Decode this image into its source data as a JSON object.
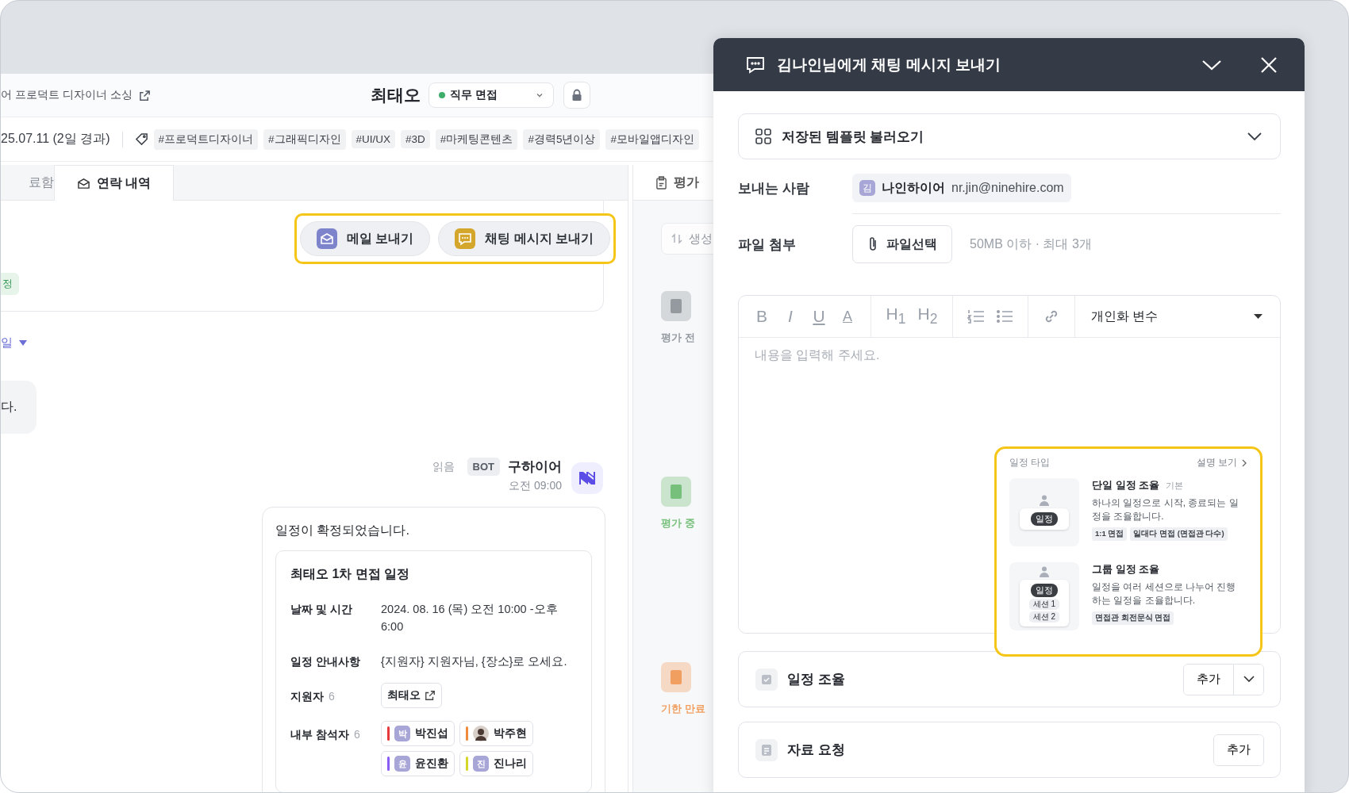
{
  "page": {
    "breadcrumb": "어 프로덕트 디자이너 소싱",
    "candidate_name": "최태오",
    "stage": {
      "label": "직무 면접",
      "color": "#3fae6a"
    },
    "date": "25.07.11 (2일 경과)",
    "tags": [
      "#프로덕트디자이너",
      "#그래픽디자인",
      "#UI/UX",
      "#3D",
      "#마케팅콘텐츠",
      "#경력5년이상",
      "#모바일앱디자인"
    ]
  },
  "tabs": [
    {
      "label": "료함",
      "selected": false
    },
    {
      "label": "연락 내역",
      "selected": true
    }
  ],
  "actions": [
    {
      "kind": "mail",
      "label": "메일 보내기"
    },
    {
      "kind": "chat",
      "label": "채팅 메시지 보내기"
    }
  ],
  "timeline": {
    "status_tag": "정",
    "filter": "일",
    "bubble": "다.",
    "message": {
      "read": "읽음",
      "badge": "BOT",
      "sender": "구하이어",
      "time": "오전 09:00",
      "text": "일정이 확정되었습니다.",
      "schedule": {
        "title": "최태오 1차 면접 일정",
        "rows": [
          {
            "kind": "text",
            "label": "날짜 및 시간",
            "value": "2024. 08. 16 (목) 오전 10:00 -오후 6:00"
          },
          {
            "kind": "text",
            "label": "일정 안내사항",
            "value": "{지원자} 지원자님, {장소}로 오세요."
          },
          {
            "kind": "applicants",
            "label": "지원자",
            "count": "6",
            "people": [
              {
                "name": "최태오"
              }
            ]
          },
          {
            "kind": "participants",
            "label": "내부 참석자",
            "count": "6",
            "people": [
              {
                "kind": "initial",
                "initial": "박",
                "name": "박진섭",
                "color": "#e5393b"
              },
              {
                "kind": "photo",
                "name": "박주현",
                "color": "#f08a3c"
              },
              {
                "kind": "initial",
                "initial": "윤",
                "name": "윤진환",
                "color": "#8a5cf6"
              },
              {
                "kind": "initial",
                "initial": "진",
                "name": "진나리",
                "color": "#d6d62a"
              }
            ]
          }
        ]
      }
    }
  },
  "evaluation": {
    "tab": "평가",
    "sort": "생성",
    "cards": [
      {
        "kind": "before",
        "label": "평가 전"
      },
      {
        "kind": "during",
        "label": "평가 중"
      },
      {
        "kind": "expired",
        "label": "기한 만료"
      }
    ]
  },
  "dialog": {
    "title": "김나인님에게 채팅 메시지 보내기",
    "template": "저장된 템플릿 불러오기",
    "sender": {
      "label": "보내는 사람",
      "initial": "김",
      "name": "나인하이어",
      "email": "nr.jin@ninehire.com"
    },
    "attachment": {
      "label": "파일 첨부",
      "button": "파일선택",
      "hint": "50MB 이하 · 최대 3개"
    },
    "editor": {
      "format_buttons": [
        "B",
        "I",
        "U",
        "A"
      ],
      "heading_buttons": [
        "H$_{1}$",
        "H$_{2}$"
      ],
      "variables": "개인화 변수",
      "placeholder": "내용을 입력해 주세요."
    },
    "schedule_popup": {
      "title": "일정 타입",
      "link": "설명 보기",
      "types": [
        {
          "kind": "single",
          "title": "단일 일정 조율",
          "badge": "기본",
          "description": "하나의 일정으로 시작, 종료되는 일정을 조율합니다.",
          "chip": "일정",
          "tags": [
            "1:1 면접",
            "일대다 면접 (면접관 다수)"
          ]
        },
        {
          "kind": "group",
          "title": "그룹 일정 조율",
          "description": "일정을 여러 세션으로 나누어 진행하는 일정을 조율합니다.",
          "chip": "일정",
          "sessions": [
            "세션 1",
            "세션 2"
          ],
          "tags": [
            "면접관 회전문식 면접"
          ]
        }
      ]
    },
    "sections": [
      {
        "kind": "schedule",
        "label": "일정 조율",
        "button": "추가",
        "has_menu": true
      },
      {
        "kind": "request",
        "label": "자료 요청",
        "button": "추가",
        "has_menu": false
      }
    ]
  }
}
